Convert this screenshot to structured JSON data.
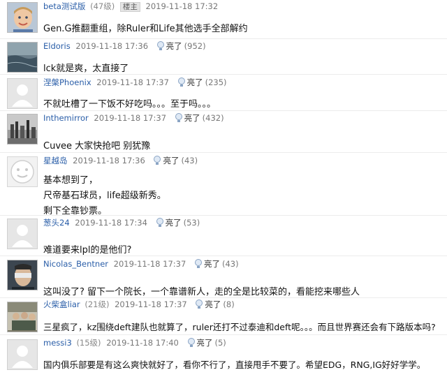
{
  "like_label": "亮了",
  "posts": [
    {
      "user": "beta测试版",
      "level": "(47级)",
      "badge": "楼主",
      "time": "2019-11-18 17:32",
      "likes": "",
      "lines": [
        "Gen.G推翻重组，除Ruler和Life其他选手全部解约"
      ],
      "avatar": "child-photo"
    },
    {
      "user": "Eldoris",
      "level": "",
      "badge": "",
      "time": "2019-11-18 17:36",
      "likes": "(952)",
      "lines": [
        "lck就是爽，太直接了"
      ],
      "avatar": "sea-photo"
    },
    {
      "user": "涅槃Phoenix",
      "level": "",
      "badge": "",
      "time": "2019-11-18 17:37",
      "likes": "(235)",
      "lines": [
        "不就吐槽了一下饭不好吃吗。。。至于吗。。。"
      ],
      "avatar": "default"
    },
    {
      "user": "Inthemirror",
      "level": "",
      "badge": "",
      "time": "2019-11-18 17:37",
      "likes": "(432)",
      "lines": [
        "Cuvee 大家快抢吧 别犹豫"
      ],
      "avatar": "city-photo"
    },
    {
      "user": "星越岛",
      "level": "",
      "badge": "",
      "time": "2019-11-18 17:36",
      "likes": "(43)",
      "lines": [
        "基本想到了，",
        "尺帝基石球员，life超级新秀。",
        "剩下全靠钞票。"
      ],
      "avatar": "cartoon"
    },
    {
      "user": "葱头24",
      "level": "",
      "badge": "",
      "time": "2019-11-18 17:34",
      "likes": "(53)",
      "lines": [
        "难道要来lpl的是他们?"
      ],
      "avatar": "default"
    },
    {
      "user": "Nicolas_Bentner",
      "level": "",
      "badge": "",
      "time": "2019-11-18 17:37",
      "likes": "(43)",
      "lines": [
        "这叫没了? 留下一个院长，一个靠谱新人，走的全是比较菜的，看能挖来哪些人"
      ],
      "avatar": "face-photo"
    },
    {
      "user": "火柴盒liar",
      "level": "(21级)",
      "badge": "",
      "time": "2019-11-18 17:37",
      "likes": "(8)",
      "lines": [
        "三星疯了，kz围绕deft建队也就算了，ruler还打不过泰迪和deft呢。。。而且世界赛还会有下路版本吗?"
      ],
      "avatar": "group-photo"
    },
    {
      "user": "messi3",
      "level": "(15级)",
      "badge": "",
      "time": "2019-11-18 17:40",
      "likes": "(5)",
      "lines": [
        "国内俱乐部要是有这么爽快就好了，看你不行了，直接甩手不要了。希望EDG，RNG,IG好好学学。"
      ],
      "avatar": "default"
    }
  ]
}
